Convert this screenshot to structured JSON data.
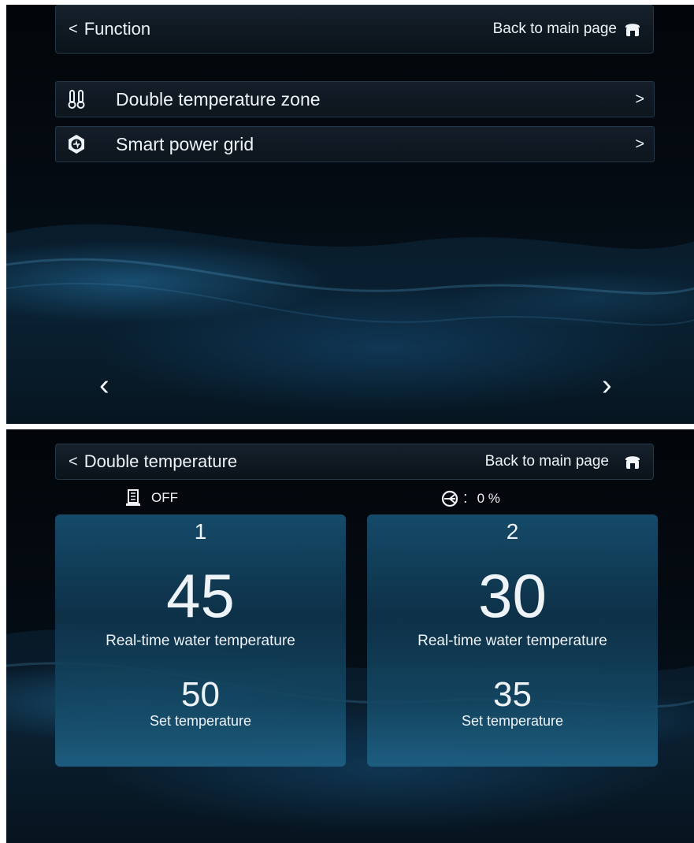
{
  "screen1": {
    "header": {
      "back_label": "Function",
      "main_label": "Back to main page"
    },
    "menu": [
      {
        "label": "Double temperature zone",
        "icon": "thermometers-icon"
      },
      {
        "label": "Smart power grid",
        "icon": "power-grid-icon"
      }
    ],
    "nav": {
      "prev": "‹",
      "next": "›"
    }
  },
  "screen2": {
    "header": {
      "back_label": "Double temperature",
      "main_label": "Back to main page"
    },
    "status": {
      "heater_state": "OFF",
      "pump_colon": ":",
      "pump_value": "0 %"
    },
    "zones": [
      {
        "number": "1",
        "real_temp": "45",
        "real_label": "Real-time water temperature",
        "set_temp": "50",
        "set_label": "Set temperature"
      },
      {
        "number": "2",
        "real_temp": "30",
        "real_label": "Real-time water temperature",
        "set_temp": "35",
        "set_label": "Set temperature"
      }
    ]
  },
  "colors": {
    "card": "#175a80",
    "text": "#eef3f7",
    "border": "#263845"
  }
}
